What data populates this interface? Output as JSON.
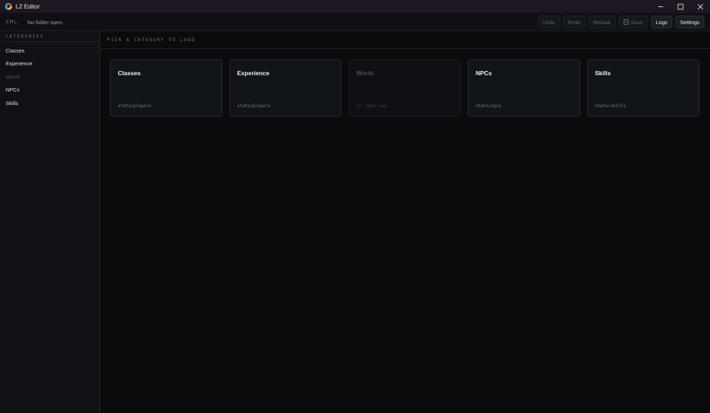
{
  "window": {
    "title": "L2 Editor",
    "controls": [
      "minimize-icon",
      "maximize-icon",
      "close-icon"
    ]
  },
  "toolbar": {
    "brand": "XML",
    "status": "No folder open.",
    "buttons": [
      {
        "label": "Undo",
        "enabled": false
      },
      {
        "label": "Redo",
        "enabled": false
      },
      {
        "label": "Reload",
        "enabled": false
      },
      {
        "label": "Save",
        "enabled": false,
        "icon": "save-icon"
      },
      {
        "label": "Logs",
        "enabled": true
      },
      {
        "label": "Settings",
        "enabled": true
      }
    ]
  },
  "sidebar": {
    "heading": "CATEGORIES",
    "items": [
      {
        "label": "Classes",
        "enabled": true
      },
      {
        "label": "Experience",
        "enabled": true
      },
      {
        "label": "World",
        "enabled": false
      },
      {
        "label": "NPCs",
        "enabled": true
      },
      {
        "label": "Skills",
        "enabled": true
      }
    ]
  },
  "main": {
    "heading": "PICK A CATEGORY TO LOAD",
    "cards": [
      {
        "title": "Classes",
        "path": "stats/players",
        "enabled": true
      },
      {
        "title": "Experience",
        "path": "stats/players",
        "enabled": true
      },
      {
        "title": "World",
        "path": "no radar map",
        "enabled": false
      },
      {
        "title": "NPCs",
        "path": "stats/npcs",
        "enabled": true
      },
      {
        "title": "Skills",
        "path": "stats/skills",
        "enabled": true
      }
    ]
  }
}
